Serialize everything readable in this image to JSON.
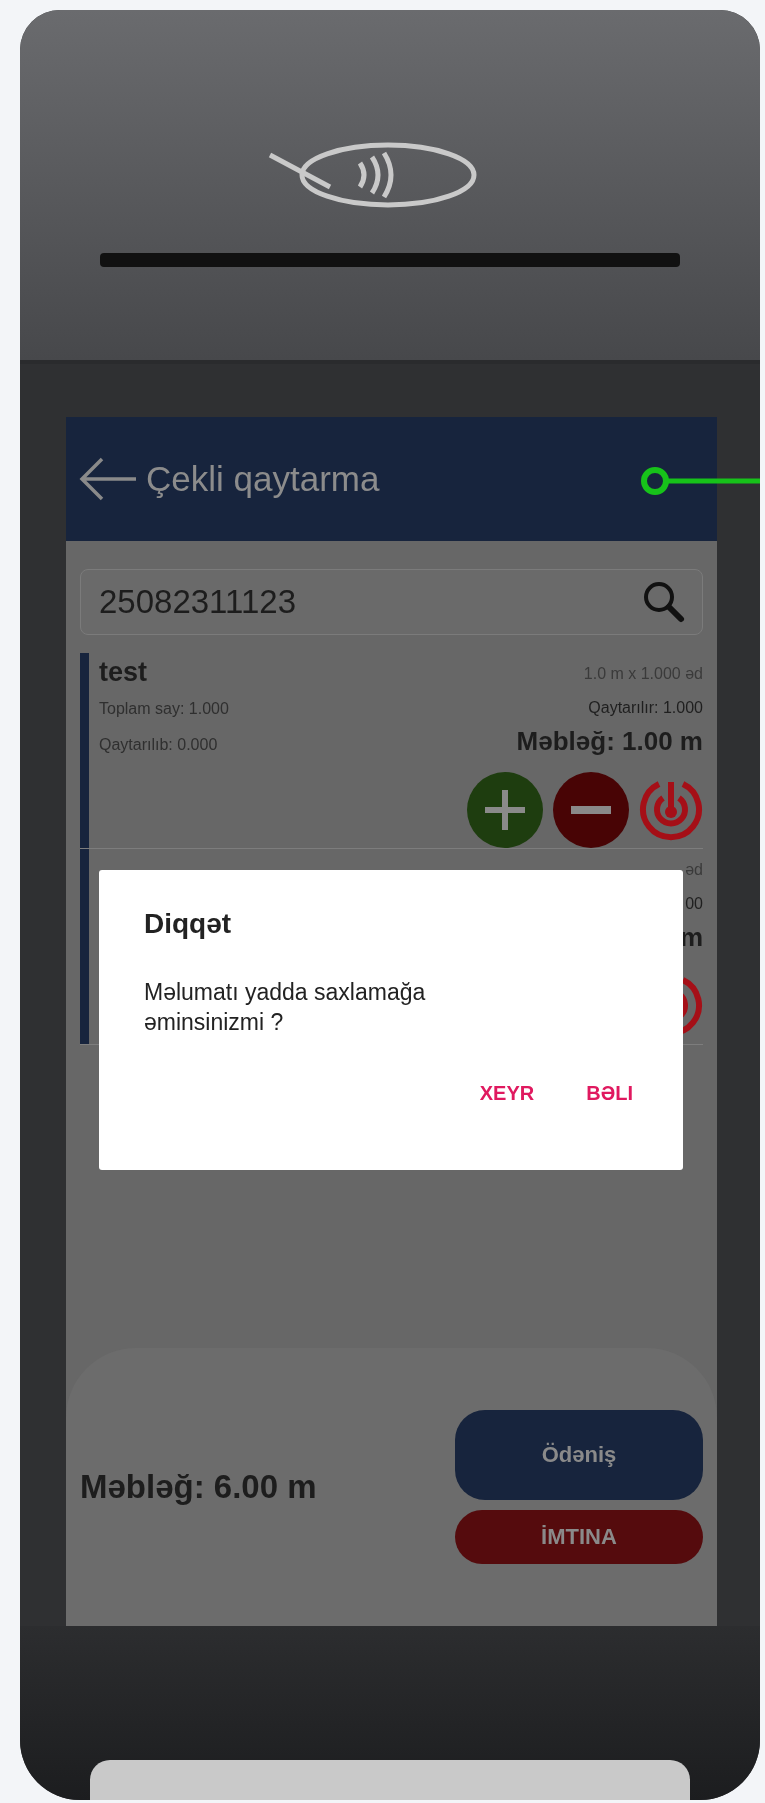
{
  "header": {
    "title": "Çekli qaytarma"
  },
  "search": {
    "value": "25082311123"
  },
  "items": [
    {
      "name": "test",
      "unit_price": "1.0 m x 1.000 əd",
      "total_count": "Toplam say: 1.000",
      "returning": "Qaytarılır: 1.000",
      "returned": "Qaytarılıb: 0.000",
      "amount": "Məbləğ: 1.00 m"
    },
    {
      "unit_price": "əd",
      "returning": "00",
      "amount": "m"
    }
  ],
  "dialog": {
    "title": "Diqqət",
    "message": "Məlumatı yadda saxlamağa əminsinizmi ?",
    "buttons": [
      "XEYR",
      "BƏLI"
    ]
  },
  "footer": {
    "total": "Məbləğ: 6.00 m",
    "pay_button": "Ödəniş",
    "cancel_button": "İMTINA"
  }
}
